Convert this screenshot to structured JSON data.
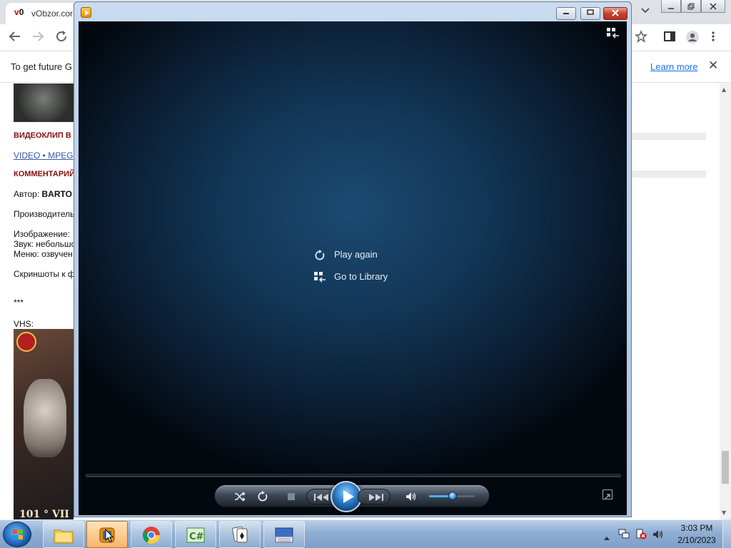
{
  "browser": {
    "tab_title": "vObzor.cor",
    "favicon_text_red": "v",
    "favicon_text_dark": "0",
    "tabs_menu_icon": "chevron-down-icon",
    "window_controls": [
      "minimize-icon",
      "restore-icon",
      "close-icon"
    ],
    "toolbar_icons": [
      "back-icon",
      "forward-icon",
      "reload-icon",
      "star-icon",
      "sidebar-icon",
      "profile-icon",
      "kebab-menu-icon"
    ],
    "infobar": {
      "text": "To get future G",
      "learn_more": "Learn more",
      "close": "✕"
    },
    "page": {
      "heading_videoclip": "ВИДЕОКЛИП В",
      "video_link": "VIDEO • MPEG",
      "heading_comments": "КОММЕНТАРИЙ",
      "author_label": "Автор: ",
      "author_name": "BARTO",
      "producer": "Производитель",
      "image_label": "Изображение: ",
      "sound_label": "Звук: небольшо",
      "menu_label": "Меню: озвучен",
      "screenshots": "Скриншоты к ф",
      "stars": "***",
      "vhs": "VHS:",
      "cover_title": "101 ° VII"
    }
  },
  "wmp": {
    "window_icon": "media-player-icon",
    "caption_buttons": [
      "minimize",
      "maximize",
      "close"
    ],
    "menu": {
      "play_again": "Play again",
      "go_to_library": "Go to Library"
    },
    "controls": {
      "shuffle_icon": "shuffle-icon",
      "repeat_icon": "repeat-icon",
      "stop_icon": "stop-icon",
      "previous_icon": "previous-icon",
      "play_icon": "play-icon",
      "next_icon": "next-icon",
      "mute_icon": "volume-icon",
      "volume_level": 0.5,
      "fullscreen_icon": "fullscreen-icon"
    },
    "accent": "#2a7bc7"
  },
  "taskbar": {
    "apps": [
      {
        "name": "file-explorer",
        "icon": "folder-icon"
      },
      {
        "name": "windows-media-player",
        "icon": "media-player-icon",
        "active": true
      },
      {
        "name": "chrome",
        "icon": "chrome-icon"
      },
      {
        "name": "csharp-editor",
        "icon": "csharp-icon",
        "label": "C#"
      },
      {
        "name": "solitaire",
        "icon": "cards-icon"
      },
      {
        "name": "on-screen-keyboard",
        "icon": "keyboard-icon"
      }
    ],
    "tray_icons": [
      "show-hidden-icons-arrow",
      "network-icon",
      "action-center-icon",
      "volume-icon"
    ],
    "clock": {
      "time": "3:03 PM",
      "date": "2/10/2023"
    }
  }
}
